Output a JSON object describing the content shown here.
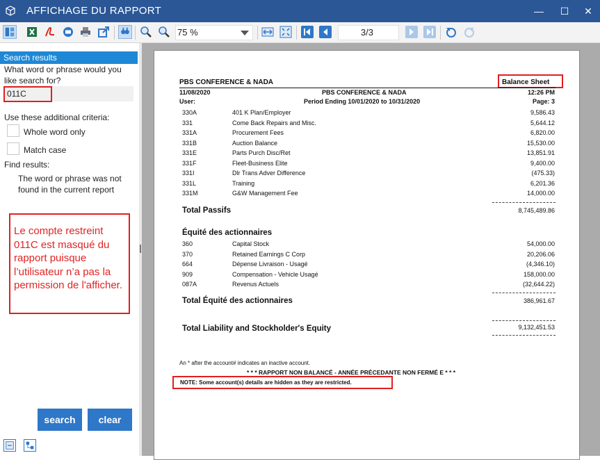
{
  "window": {
    "title": "AFFICHAGE DU RAPPORT",
    "minimize": "—",
    "maximize": "☐",
    "close": "✕"
  },
  "toolbar": {
    "zoom_value": "75 %",
    "page_indicator": "3/3"
  },
  "search_panel": {
    "header": "Search results",
    "question": "What word or phrase would you like search for?",
    "search_value": "011C",
    "criteria_label": "Use these additional criteria:",
    "whole_word_label": "Whole word only",
    "match_case_label": "Match case",
    "find_results_label": "Find results:",
    "result_message": "The word or phrase was not found in the current report",
    "annotation": "Le compte restreint 011C est masqué du rapport puisque l’utilisateur n’a pas la permission de l'afficher.",
    "search_button": "search",
    "clear_button": "clear"
  },
  "report": {
    "company_top": "PBS CONFERENCE & NADA",
    "report_type": "Balance Sheet",
    "date": "11/08/2020",
    "company_center": "PBS CONFERENCE & NADA",
    "time": "12:26 PM",
    "user_label": "User:",
    "period": "Period Ending 10/01/2020 to 10/31/2020",
    "page": "Page: 3",
    "liability_rows": [
      {
        "account": "330A",
        "description": "401 K Plan/Employer",
        "amount": "9,586.43"
      },
      {
        "account": "331",
        "description": "Come Back Repairs and Misc.",
        "amount": "5,644.12"
      },
      {
        "account": "331A",
        "description": "Procurement Fees",
        "amount": "6,820.00"
      },
      {
        "account": "331B",
        "description": "Auction Balance",
        "amount": "15,530.00"
      },
      {
        "account": "331E",
        "description": "Parts Purch Disc/Ret",
        "amount": "13,851.91"
      },
      {
        "account": "331F",
        "description": "Fleet-Business Elite",
        "amount": "9,400.00"
      },
      {
        "account": "331I",
        "description": "Dlr Trans Adver Difference",
        "amount": "(475.33)"
      },
      {
        "account": "331L",
        "description": "Training",
        "amount": "6,201.36"
      },
      {
        "account": "331M",
        "description": "G&W Management Fee",
        "amount": "14,000.00"
      }
    ],
    "total_liabilities_label": "Total  Passifs",
    "total_liabilities_value": "8,745,489.86",
    "equity_heading": "Équité des actionnaires",
    "equity_rows": [
      {
        "account": "360",
        "description": "Capital Stock",
        "amount": "54,000.00"
      },
      {
        "account": "370",
        "description": "Retained Earnings C Corp",
        "amount": "20,206.06"
      },
      {
        "account": "664",
        "description": "Dépense Livraison - Usagé",
        "amount": "(4,346.10)"
      },
      {
        "account": "909",
        "description": "Compensation - Vehicle Usagé",
        "amount": "158,000.00"
      },
      {
        "account": "087A",
        "description": "Revenus Actuels",
        "amount": "(32,644.22)"
      }
    ],
    "total_equity_label": "Total  Équité des actionnaires",
    "total_equity_value": "386,961.67",
    "grand_total_label": "Total Liability and Stockholder's Equity",
    "grand_total_value": "9,132,451.53",
    "inactive_note": "An * after the account# indicates an inactive account.",
    "unbalanced_note": "* * * RAPPORT NON BALANCÉ  - ANNÉE PRÉCEDANTE NON FERMÉ E * * *",
    "restricted_note": "NOTE: Some account(s) details are hidden as they are restricted."
  },
  "colors": {
    "titlebar": "#2b5797",
    "accent": "#1e88d6",
    "button": "#2f77c8",
    "highlight": "#e01f1f"
  },
  "icons": [
    "cube-icon",
    "page-layout-icon",
    "excel-icon",
    "pdf-icon",
    "email-icon",
    "print-icon",
    "export-icon",
    "find-icon",
    "zoom-in-icon",
    "zoom-out-icon",
    "page-width-icon",
    "whole-page-icon",
    "first-page-icon",
    "previous-page-icon",
    "next-page-icon",
    "last-page-icon",
    "back-icon",
    "refresh-icon",
    "toggle-panel-icon",
    "group-tree-icon"
  ]
}
